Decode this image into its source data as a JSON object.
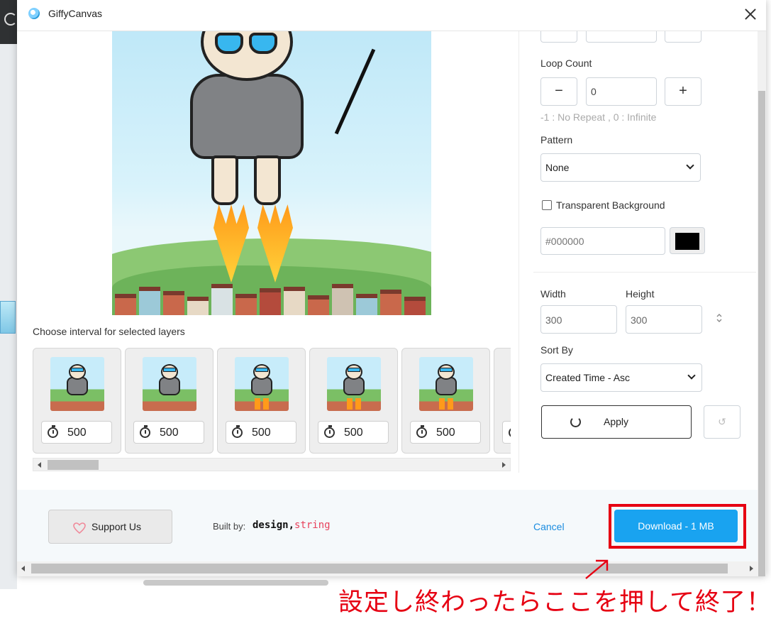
{
  "window": {
    "title": "GiffyCanvas"
  },
  "preview": {
    "section_label": "Choose interval for selected layers"
  },
  "layers": [
    {
      "interval": "500"
    },
    {
      "interval": "500"
    },
    {
      "interval": "500"
    },
    {
      "interval": "500"
    },
    {
      "interval": "500"
    }
  ],
  "settings": {
    "loop_count": {
      "label": "Loop Count",
      "value": "0",
      "minus": "−",
      "plus": "+",
      "hint": "-1 : No Repeat , 0 : Infinite"
    },
    "pattern": {
      "label": "Pattern",
      "selected": "None"
    },
    "transparent_bg": {
      "label": "Transparent Background",
      "checked": false
    },
    "color": {
      "placeholder": "#000000",
      "swatch": "#000000"
    },
    "size": {
      "width_label": "Width",
      "height_label": "Height",
      "width": "300",
      "height": "300"
    },
    "sort": {
      "label": "Sort By",
      "selected": "Created Time - Asc"
    },
    "apply_label": "Apply"
  },
  "footer": {
    "support_label": "Support Us",
    "built_by_label": "Built by:",
    "brand_part1": "design,",
    "brand_part2": "string",
    "cancel_label": "Cancel",
    "download_label": "Download - 1 MB"
  },
  "annotation": {
    "text": "設定し終わったらここを押して終了！",
    "color": "#e60012"
  },
  "colors": {
    "accent": "#19a3f0",
    "highlight": "#e60012"
  }
}
